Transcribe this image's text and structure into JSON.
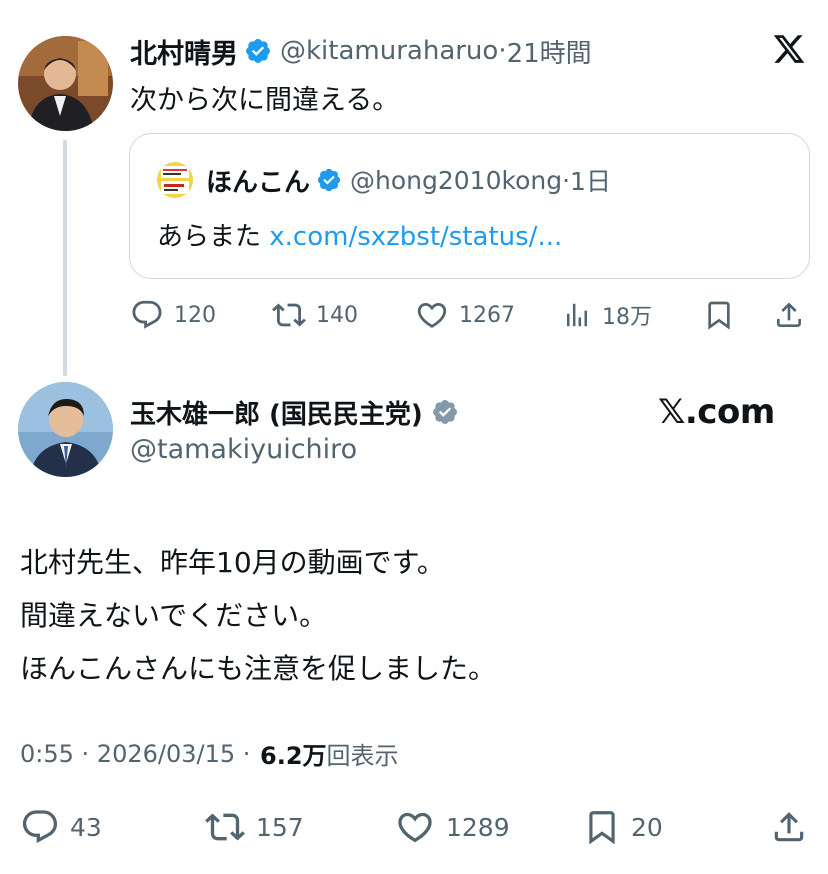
{
  "tweet1": {
    "name": "北村晴男",
    "handle": "@kitamuraharuo",
    "time": "21時間",
    "text": "次から次に間違える。",
    "verified_color": "#1d9bf0",
    "quote": {
      "name": "ほんこん",
      "handle": "@hong2010kong",
      "time": "1日",
      "text": "あらまた ",
      "link": "x.com/sxzbst/status/..."
    },
    "actions": {
      "replies": "120",
      "reposts": "140",
      "likes": "1267",
      "views": "18万"
    }
  },
  "x_logo": "x-logo-icon",
  "tweet2": {
    "name": "玉木雄一郎 (国民民主党)",
    "handle": "@tamakiyuichiro",
    "brand": "𝕏.com",
    "badge_color": "#829aab",
    "body": [
      "北村先生、昨年10月の動画です。",
      "間違えないでください。",
      "ほんこんさんにも注意を促しました。"
    ],
    "meta": {
      "time": "0:55",
      "date": "2026/03/15",
      "views_number": "6.2万",
      "views_label": "回表示"
    },
    "actions": {
      "replies": "43",
      "reposts": "157",
      "likes": "1289",
      "bookmarks": "20"
    }
  },
  "colors": {
    "text": "#0f1419",
    "secondary": "#536471",
    "link": "#1d9bf0",
    "border": "#cfd9de"
  }
}
